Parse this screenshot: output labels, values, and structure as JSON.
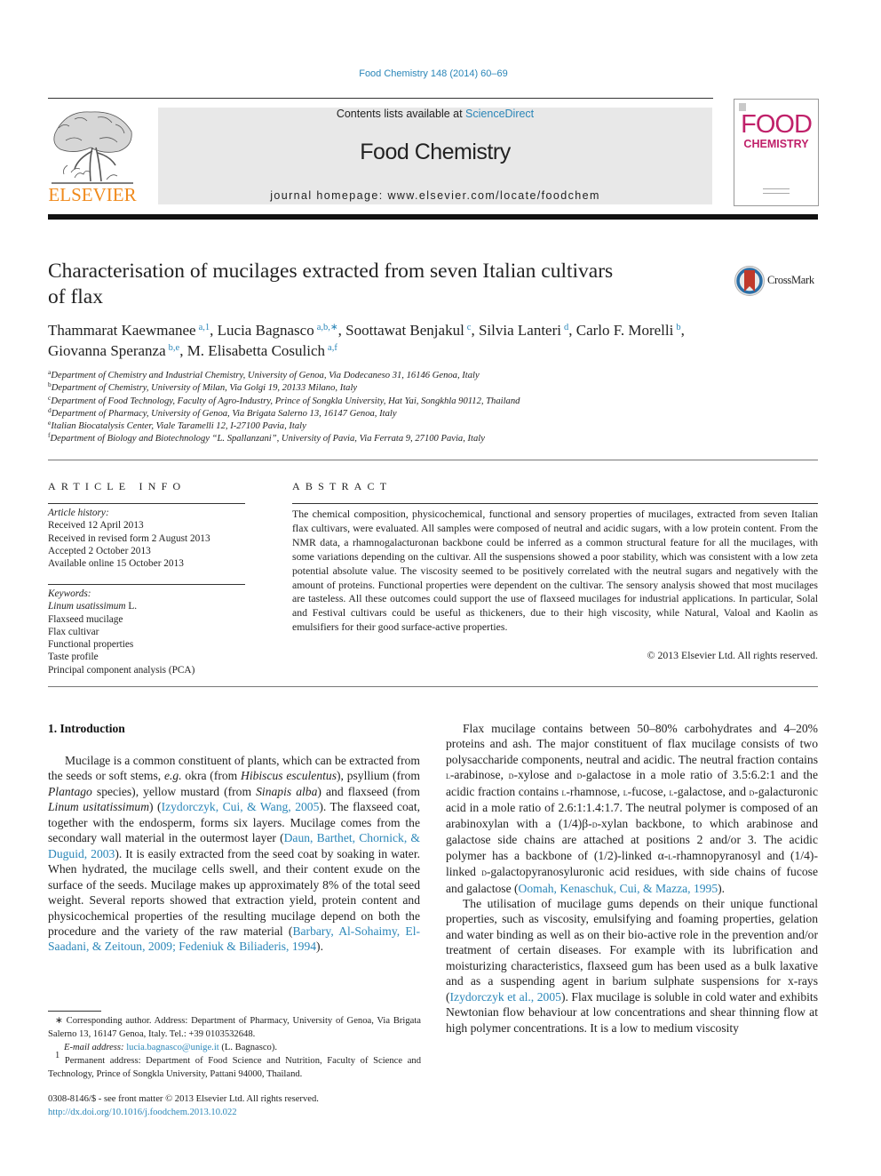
{
  "journal_ref": "Food Chemistry 148 (2014) 60–69",
  "masthead": {
    "publisher": "ELSEVIER",
    "contents_prefix": "Contents lists available at ",
    "contents_link": "ScienceDirect",
    "journal_title": "Food Chemistry",
    "homepage": "journal homepage: www.elsevier.com/locate/foodchem",
    "cover_word_1": "FOOD",
    "cover_word_2": "CHEMISTRY",
    "colors": {
      "elsevier_orange": "#f08a1c",
      "cover_magenta": "#c0216a",
      "link_blue": "#2a86b8",
      "banner_gray": "#e8e8e8"
    }
  },
  "crossmark_label": "CrossMark",
  "title_line_1": "Characterisation of mucilages extracted from seven Italian cultivars",
  "title_line_2": "of flax",
  "authors": [
    {
      "name": "Thammarat Kaewmanee",
      "sup": "a,1",
      "sep": ", "
    },
    {
      "name": "Lucia Bagnasco",
      "sup": "a,b,∗",
      "sep": ", "
    },
    {
      "name": "Soottawat Benjakul",
      "sup": "c",
      "sep": ", "
    },
    {
      "name": "Silvia Lanteri",
      "sup": "d",
      "sep": ", "
    },
    {
      "name": "Carlo F. Morelli",
      "sup": "b",
      "sep": ","
    },
    {
      "name": "Giovanna Speranza",
      "sup": "b,e",
      "sep": ", "
    },
    {
      "name": "M. Elisabetta Cosulich",
      "sup": "a,f",
      "sep": ""
    }
  ],
  "affiliations": [
    {
      "key": "a",
      "text": "Department of Chemistry and Industrial Chemistry, University of Genoa, Via Dodecaneso 31, 16146 Genoa, Italy"
    },
    {
      "key": "b",
      "text": "Department of Chemistry, University of Milan, Via Golgi 19, 20133 Milano, Italy"
    },
    {
      "key": "c",
      "text": "Department of Food Technology, Faculty of Agro-Industry, Prince of Songkla University, Hat Yai, Songkhla 90112, Thailand"
    },
    {
      "key": "d",
      "text": "Department of Pharmacy, University of Genoa, Via Brigata Salerno 13, 16147 Genoa, Italy"
    },
    {
      "key": "e",
      "text": "Italian Biocatalysis Center, Viale Taramelli 12, I-27100 Pavia, Italy"
    },
    {
      "key": "f",
      "text": "Department of Biology and Biotechnology “L. Spallanzani”, University of Pavia, Via Ferrata 9, 27100 Pavia, Italy"
    }
  ],
  "article_info": {
    "heading": "ARTICLE INFO",
    "history_label": "Article history:",
    "history": [
      "Received 12 April 2013",
      "Received in revised form 2 August 2013",
      "Accepted 2 October 2013",
      "Available online 15 October 2013"
    ],
    "keywords_label": "Keywords:",
    "keyword_italic": "Linum usatissimum",
    "keyword_italic_suffix": " L.",
    "keywords": [
      "Flaxseed mucilage",
      "Flax cultivar",
      "Functional properties",
      "Taste profile",
      "Principal component analysis (PCA)"
    ]
  },
  "abstract": {
    "heading": "ABSTRACT",
    "text": "The chemical composition, physicochemical, functional and sensory properties of mucilages, extracted from seven Italian flax cultivars, were evaluated. All samples were composed of neutral and acidic sugars, with a low protein content. From the NMR data, a rhamnogalacturonan backbone could be inferred as a common structural feature for all the mucilages, with some variations depending on the cultivar. All the suspensions showed a poor stability, which was consistent with a low zeta potential absolute value. The viscosity seemed to be positively correlated with the neutral sugars and negatively with the amount of proteins. Functional properties were dependent on the cultivar. The sensory analysis showed that most mucilages are tasteless. All these outcomes could support the use of flaxseed mucilages for industrial applications. In particular, Solal and Festival cultivars could be useful as thickeners, due to their high viscosity, while Natural, Valoal and Kaolin as emulsifiers for their good surface-active properties.",
    "copyright": "© 2013 Elsevier Ltd. All rights reserved."
  },
  "intro": {
    "heading": "1. Introduction",
    "left_p1": {
      "t1": "Mucilage is a common constituent of plants, which can be extracted from the seeds or soft stems, ",
      "i1": "e.g.",
      "t2": " okra (from ",
      "i2": "Hibiscus esculentus",
      "t3": "), psyllium (from ",
      "i3": "Plantago",
      "t4": " species), yellow mustard (from ",
      "i4": "Sinapis alba",
      "t5": ") and flaxseed (from ",
      "i5": "Linum usitatissimum",
      "t6": ") (",
      "c1": "Izydorczyk, Cui, & Wang, 2005",
      "t7": "). The flaxseed coat, together with the endosperm, forms six layers. Mucilage comes from the secondary wall material in the outermost layer (",
      "c2": "Daun, Barthet, Chornick, & Duguid, 2003",
      "t8": "). It is easily extracted from the seed coat by soaking in water. When hydrated, the mucilage cells swell, and their content exude on the surface of the seeds. Mucilage makes up approximately 8% of the total seed weight. Several reports showed that extraction yield, protein content and physicochemical properties of the resulting mucilage depend on both the procedure and the variety of the raw material (",
      "c3": "Barbary, Al-Sohaimy, El-Saadani, & Zeitoun, 2009; Fedeniuk & Biliaderis, 1994",
      "t9": ")."
    },
    "right_p1": {
      "t1": "Flax mucilage contains between 50–80% carbohydrates and 4–20% proteins and ash. The major constituent of flax mucilage consists of two polysaccharide components, neutral and acidic. The neutral fraction contains ",
      "sc1": "l",
      "t2": "-arabinose, ",
      "sc2": "d",
      "t3": "-xylose and ",
      "sc3": "d",
      "t4": "-galactose in a mole ratio of 3.5:6.2:1 and the acidic fraction contains ",
      "sc4": "l",
      "t5": "-rhamnose, ",
      "sc5": "l",
      "t6": "-fucose, ",
      "sc6": "l",
      "t7": "-galactose, and ",
      "sc7": "d",
      "t8": "-galacturonic acid in a mole ratio of 2.6:1:1.4:1.7. The neutral polymer is composed of an arabinoxylan with a (1/4)β-",
      "sc8": "d",
      "t9": "-xylan backbone, to which arabinose and galactose side chains are attached at positions 2 and/or 3. The acidic polymer has a backbone of (1/2)-linked α-",
      "sc9": "l",
      "t10": "-rhamnopyranosyl and (1/4)-linked ",
      "sc10": "d",
      "t11": "-galactopyranosyluronic acid residues, with side chains of fucose and galactose (",
      "c1": "Oomah, Kenaschuk, Cui, & Mazza, 1995",
      "t12": ")."
    },
    "right_p2": {
      "t1": "The utilisation of mucilage gums depends on their unique functional properties, such as viscosity, emulsifying and foaming properties, gelation and water binding as well as on their bio-active role in the prevention and/or treatment of certain diseases. For example with its lubrification and moisturizing characteristics, flaxseed gum has been used as a bulk laxative and as a suspending agent in barium sulphate suspensions for x-rays (",
      "c1": "Izydorczyk et al., 2005",
      "t2": "). Flax mucilage is soluble in cold water and exhibits Newtonian flow behaviour at low concentrations and shear thinning flow at high polymer concentrations. It is a low to medium viscosity"
    }
  },
  "footnotes": {
    "corresponding": "∗ Corresponding author. Address: Department of Pharmacy, University of Genoa, Via Brigata Salerno 13, 16147 Genoa, Italy. Tel.: +39 0103532648.",
    "email_label": "E-mail address:",
    "email": "lucia.bagnasco@unige.it",
    "email_suffix": " (L. Bagnasco).",
    "permanent_mark": "1",
    "permanent": " Permanent address: Department of Food Science and Nutrition, Faculty of Science and Technology, Prince of Songkla University, Pattani 94000, Thailand."
  },
  "front_matter": {
    "issn": "0308-8146/$ - see front matter © 2013 Elsevier Ltd. All rights reserved.",
    "doi": "http://dx.doi.org/10.1016/j.foodchem.2013.10.022"
  }
}
